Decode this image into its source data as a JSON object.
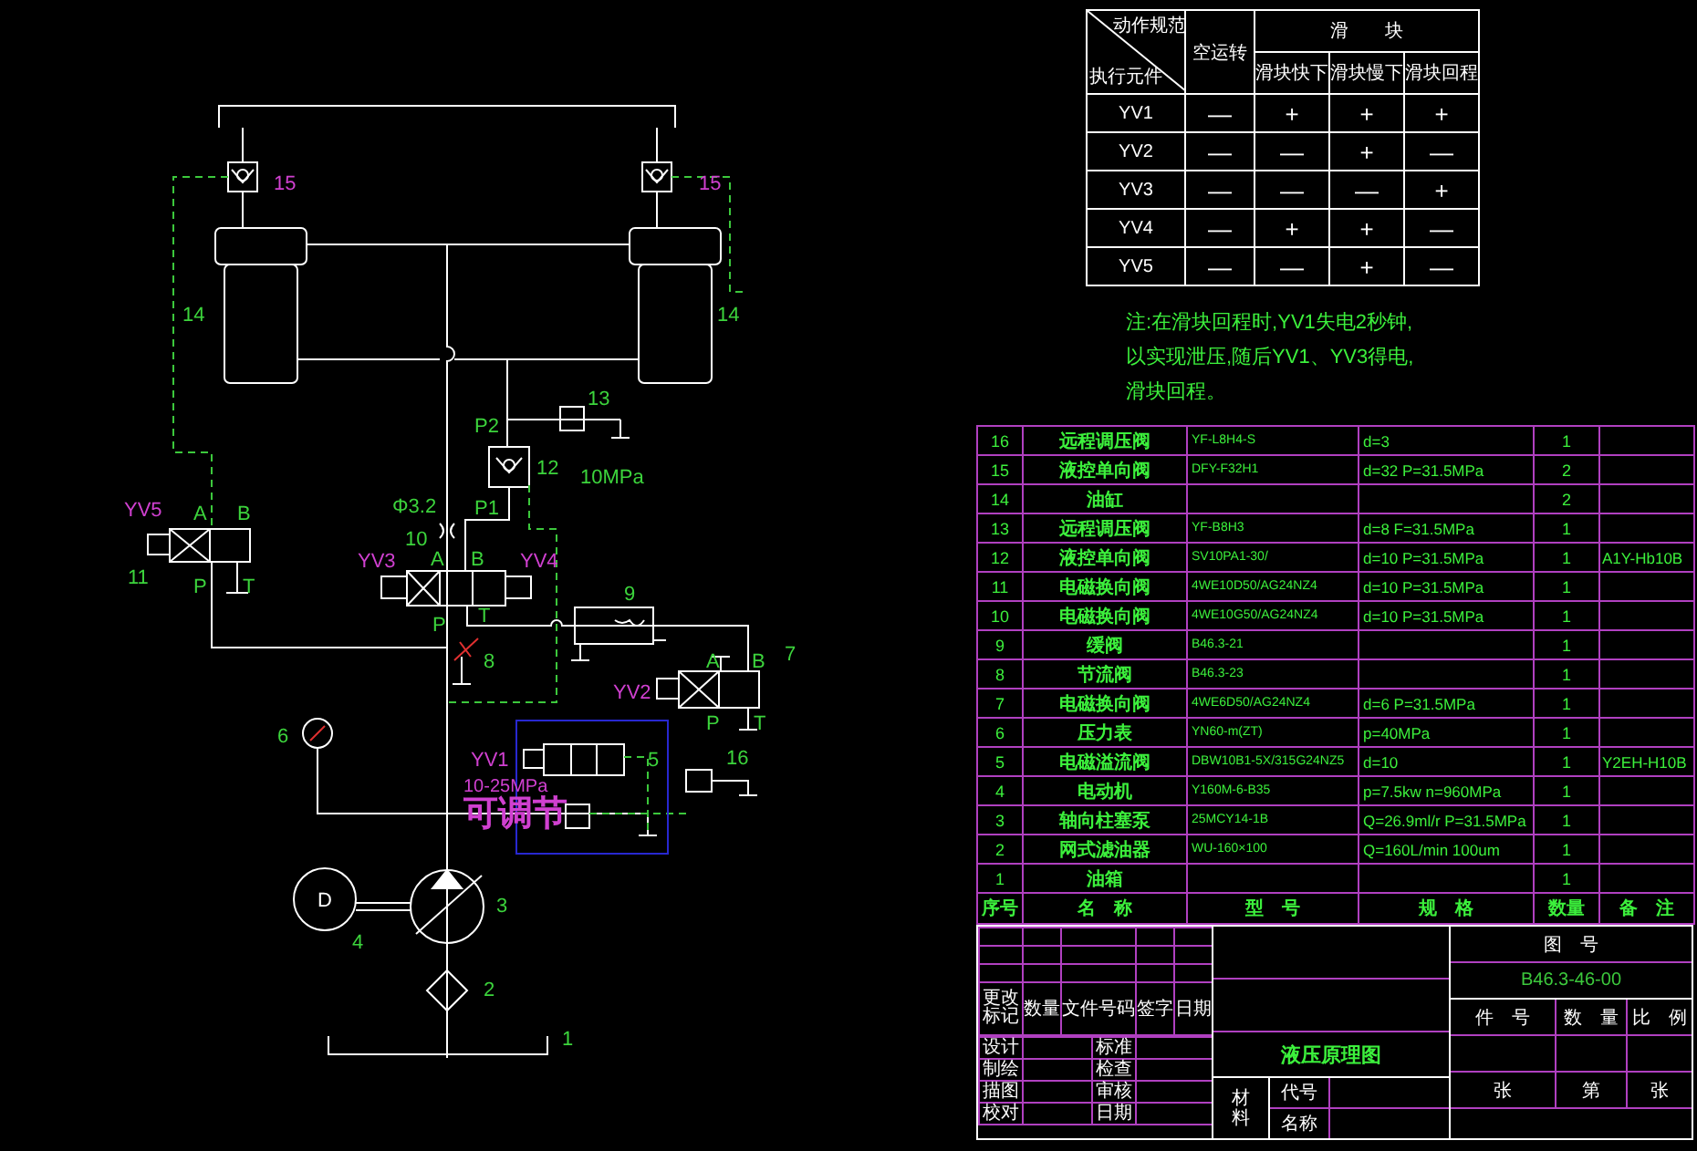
{
  "schematic": {
    "labels": [
      {
        "text": "15",
        "kind": "highlight"
      },
      {
        "text": "15",
        "kind": "highlight"
      },
      {
        "text": "14",
        "kind": "number"
      },
      {
        "text": "14",
        "kind": "number"
      },
      {
        "text": "13",
        "kind": "number"
      },
      {
        "text": "P2",
        "kind": "port"
      },
      {
        "text": "12",
        "kind": "number"
      },
      {
        "text": "10MPa",
        "kind": "number"
      },
      {
        "text": "Φ3.2",
        "kind": "number"
      },
      {
        "text": "P1",
        "kind": "port"
      },
      {
        "text": "10",
        "kind": "number"
      },
      {
        "text": "YV3",
        "kind": "solenoid"
      },
      {
        "text": "A",
        "kind": "port"
      },
      {
        "text": "B",
        "kind": "port"
      },
      {
        "text": "YV4",
        "kind": "solenoid"
      },
      {
        "text": "P",
        "kind": "port"
      },
      {
        "text": "T",
        "kind": "port"
      },
      {
        "text": "8",
        "kind": "number"
      },
      {
        "text": "9",
        "kind": "number"
      },
      {
        "text": "YV5",
        "kind": "solenoid"
      },
      {
        "text": "A",
        "kind": "port"
      },
      {
        "text": "B",
        "kind": "port"
      },
      {
        "text": "11",
        "kind": "number"
      },
      {
        "text": "P",
        "kind": "port"
      },
      {
        "text": "T",
        "kind": "port"
      },
      {
        "text": "7",
        "kind": "number"
      },
      {
        "text": "A",
        "kind": "port"
      },
      {
        "text": "B",
        "kind": "port"
      },
      {
        "text": "YV2",
        "kind": "solenoid"
      },
      {
        "text": "P",
        "kind": "port"
      },
      {
        "text": "T",
        "kind": "port"
      },
      {
        "text": "6",
        "kind": "number"
      },
      {
        "text": "YV1",
        "kind": "solenoid"
      },
      {
        "text": "10-25MPa",
        "kind": "setting"
      },
      {
        "text": "可调节",
        "kind": "callout"
      },
      {
        "text": "5",
        "kind": "number"
      },
      {
        "text": "16",
        "kind": "number"
      },
      {
        "text": "D",
        "kind": "motor"
      },
      {
        "text": "4",
        "kind": "number"
      },
      {
        "text": "3",
        "kind": "number"
      },
      {
        "text": "2",
        "kind": "number"
      },
      {
        "text": "1",
        "kind": "number"
      }
    ]
  },
  "action_table": {
    "corner_top": "动作规范",
    "corner_bottom": "执行元件",
    "idle_header": "空运转",
    "group_header": "滑　　块",
    "stage_headers": [
      "滑块快下",
      "滑块慢下",
      "滑块回程"
    ],
    "rows": [
      {
        "element": "YV1",
        "values": [
          "—",
          "+",
          "+",
          "+"
        ]
      },
      {
        "element": "YV2",
        "values": [
          "—",
          "—",
          "+",
          "—"
        ]
      },
      {
        "element": "YV3",
        "values": [
          "—",
          "—",
          "—",
          "+"
        ]
      },
      {
        "element": "YV4",
        "values": [
          "—",
          "+",
          "+",
          "—"
        ]
      },
      {
        "element": "YV5",
        "values": [
          "—",
          "—",
          "+",
          "—"
        ]
      }
    ]
  },
  "note": [
    "注:在滑块回程时,YV1失电2秒钟,",
    "以实现泄压,随后YV1、YV3得电,",
    "滑块回程。"
  ],
  "parts_list": {
    "rows": [
      [
        "16",
        "远程调压阀",
        "YF-L8H4-S",
        "d=3",
        "1",
        ""
      ],
      [
        "15",
        "液控单向阀",
        "DFY-F32H1",
        "d=32  P=31.5MPa",
        "2",
        ""
      ],
      [
        "14",
        "油缸",
        "",
        "",
        "2",
        ""
      ],
      [
        "13",
        "远程调压阀",
        "YF-B8H3",
        "d=8  F=31.5MPa",
        "1",
        ""
      ],
      [
        "12",
        "液控单向阀",
        "SV10PA1-30/",
        "d=10  P=31.5MPa",
        "1",
        "A1Y-Hb10B"
      ],
      [
        "11",
        "电磁换向阀",
        "4WE10D50/AG24NZ4",
        "d=10  P=31.5MPa",
        "1",
        ""
      ],
      [
        "10",
        "电磁换向阀",
        "4WE10G50/AG24NZ4",
        "d=10  P=31.5MPa",
        "1",
        ""
      ],
      [
        "9",
        "缓阀",
        "B46.3-21",
        "",
        "1",
        ""
      ],
      [
        "8",
        "节流阀",
        "B46.3-23",
        "",
        "1",
        ""
      ],
      [
        "7",
        "电磁换向阀",
        "4WE6D50/AG24NZ4",
        "d=6  P=31.5MPa",
        "1",
        ""
      ],
      [
        "6",
        "压力表",
        "YN60-m(ZT)",
        "p=40MPa",
        "1",
        ""
      ],
      [
        "5",
        "电磁溢流阀",
        "DBW10B1-5X/315G24NZ5",
        "d=10",
        "1",
        "Y2EH-H10B"
      ],
      [
        "4",
        "电动机",
        "Y160M-6-B35",
        "p=7.5kw  n=960MPa",
        "1",
        ""
      ],
      [
        "3",
        "轴向柱塞泵",
        "25MCY14-1B",
        "Q=26.9ml/r  P=31.5MPa",
        "1",
        ""
      ],
      [
        "2",
        "网式滤油器",
        "WU-160×100",
        "Q=160L/min  100um",
        "1",
        ""
      ],
      [
        "1",
        "油箱",
        "",
        "",
        "1",
        ""
      ]
    ],
    "footer_labels": [
      "序号",
      "名　称",
      "型　号",
      "规　格",
      "数量",
      "备　注"
    ]
  },
  "title_block": {
    "revision_headers": [
      "更改标记",
      "数量",
      "文件号码",
      "签字",
      "日期"
    ],
    "signoff_rows": [
      [
        "设计",
        "标准"
      ],
      [
        "制绘",
        "检查"
      ],
      [
        "描图",
        "审核"
      ],
      [
        "校对",
        "日期"
      ]
    ],
    "drawing_title": "液压原理图",
    "material_label": "材料",
    "code_label": "代号",
    "name_label": "名称",
    "drawing_number_label": "图　号",
    "drawing_number": "B46.3-46-00",
    "info_headers": [
      "件　号",
      "数　量",
      "比　例"
    ],
    "sheet_row": [
      "张",
      "第",
      "张"
    ]
  }
}
